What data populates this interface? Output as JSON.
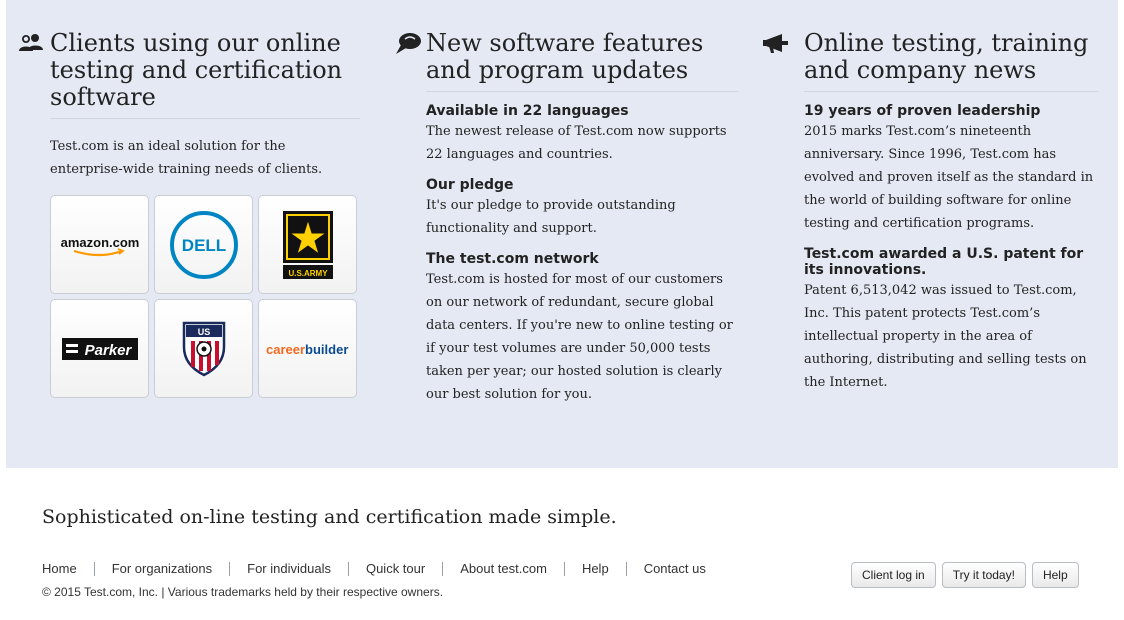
{
  "columns": {
    "clients": {
      "icon": "people-icon",
      "title": "Clients using our online testing and certification software",
      "intro": "Test.com is an ideal solution for the enterprise-wide training needs of clients.",
      "logos": [
        {
          "name": "amazon-logo",
          "text": "amazon.com"
        },
        {
          "name": "dell-logo",
          "text": "DELL"
        },
        {
          "name": "us-army-logo",
          "text": "U.S.ARMY"
        },
        {
          "name": "parker-logo",
          "text": "Parker"
        },
        {
          "name": "us-soccer-logo",
          "text": "US"
        },
        {
          "name": "careerbuilder-logo",
          "text_a": "career",
          "text_b": "builder"
        }
      ]
    },
    "features": {
      "icon": "speech-bubble-icon",
      "title": "New software features and program updates",
      "items": [
        {
          "heading": "Available in 22 languages",
          "body": "The newest release of Test.com now supports 22 languages and countries."
        },
        {
          "heading": "Our pledge",
          "body": "It's our pledge to provide outstanding functionality and support."
        },
        {
          "heading": "The test.com network",
          "body": "Test.com is hosted for most of our customers on our network of redundant, secure global data centers. If you're new to online testing or if your test volumes are under 50,000 tests taken per year; our hosted solution is clearly our best solution for you."
        }
      ]
    },
    "news": {
      "icon": "megaphone-icon",
      "title": "Online testing, training and company news",
      "items": [
        {
          "heading": "19 years of proven leadership",
          "body": "2015 marks Test.com’s nineteenth anniversary. Since 1996, Test.com has evolved and proven itself as the standard in the world of building software for online testing and certification programs."
        },
        {
          "heading": "Test.com awarded a U.S. patent for its innovations.",
          "body": "Patent 6,513,042 was issued to Test.com, Inc.  This patent protects Test.com’s intellectual property in the area of authoring, distributing and selling tests on the Internet."
        }
      ]
    }
  },
  "footer": {
    "tagline": "Sophisticated on-line testing and certification made simple.",
    "nav": [
      "Home",
      "For organizations",
      "For individuals",
      "Quick tour",
      "About test.com",
      "Help",
      "Contact us"
    ],
    "copyright": "© 2015 Test.com, Inc. | Various trademarks held by their respective owners.",
    "buttons": [
      "Client log in",
      "Try it today!",
      "Help"
    ]
  },
  "colors": {
    "panel_bg": "#e4e9f3",
    "dell_blue": "#0085c3",
    "army_gold": "#ffd100",
    "amazon_orange": "#ff9900",
    "careerbuilder_orange": "#f26b21",
    "careerbuilder_blue": "#0a4a8f"
  }
}
